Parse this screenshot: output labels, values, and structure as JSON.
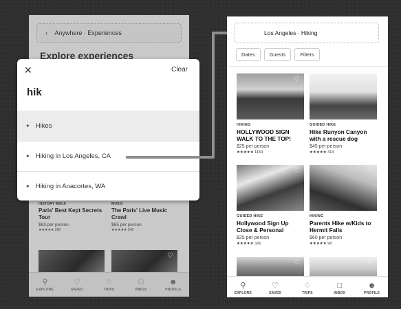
{
  "colors": {
    "background": "#2f2f2f",
    "accent": "#888888"
  },
  "left_screen": {
    "breadcrumb": "Anywhere · Experiences",
    "title": "Explore experiences",
    "cards": [
      {
        "category": "HISTORY WALK",
        "title": "Paris' Best Kept Secrets Tour",
        "price": "$63 per person",
        "rating": "★★★★★ 290"
      },
      {
        "category": "MUSIC",
        "title": "The Paris' Live Music Crawl",
        "price": "$65 per person",
        "rating": "★★★★★ 342"
      }
    ],
    "tabs": [
      {
        "label": "EXPLORE",
        "icon": "search-icon"
      },
      {
        "label": "SAVED",
        "icon": "heart-icon"
      },
      {
        "label": "TRIPS",
        "icon": "airbnb-logo-icon"
      },
      {
        "label": "INBOX",
        "icon": "message-icon"
      },
      {
        "label": "PROFILE",
        "icon": "person-icon"
      }
    ]
  },
  "search_overlay": {
    "close_icon": "close-icon",
    "clear_label": "Clear",
    "query": "hik",
    "suggestions": [
      {
        "label": "Hikes",
        "icon": "sparkle-icon"
      },
      {
        "label": "Hiking in Los Angeles, CA",
        "icon": "sparkle-icon"
      },
      {
        "label": "Hiking in Anacortes, WA",
        "icon": "sparkle-icon"
      }
    ]
  },
  "right_screen": {
    "breadcrumb": "Los Angeles · Hiking",
    "filters": [
      "Dates",
      "Guests",
      "Filters"
    ],
    "cards": [
      {
        "category": "HIKING",
        "title": "HOLLYWOOD SIGN WALK TO THE TOP!",
        "price": "$25 per person",
        "rating": "★★★★★ 1150"
      },
      {
        "category": "GUIDED HIKE",
        "title": "Hike Runyon Canyon with a rescue dog",
        "price": "$45 per person",
        "rating": "★★★★★ 414"
      },
      {
        "category": "GUIDED HIKE",
        "title": "Hollywood Sign Up Close & Personal",
        "price": "$25 per person",
        "rating": "★★★★★ 326"
      },
      {
        "category": "HIKING",
        "title": "Parents Hike w/Kids to Hermit Falls",
        "price": "$60 per person",
        "rating": "★★★★★ 98"
      }
    ],
    "tabs": [
      {
        "label": "EXPLORE",
        "icon": "search-icon"
      },
      {
        "label": "SAVED",
        "icon": "heart-icon"
      },
      {
        "label": "TRIPS",
        "icon": "airbnb-logo-icon"
      },
      {
        "label": "INBOX",
        "icon": "message-icon"
      },
      {
        "label": "PROFILE",
        "icon": "person-icon"
      }
    ]
  }
}
